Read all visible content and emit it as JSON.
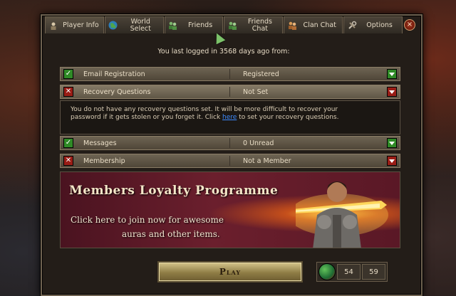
{
  "tabs": [
    {
      "label": "Player Info",
      "icon": "player-info-icon",
      "active": true
    },
    {
      "label": "World Select",
      "icon": "globe-icon",
      "active": false
    },
    {
      "label": "Friends",
      "icon": "friends-icon",
      "active": false
    },
    {
      "label": "Friends Chat",
      "icon": "friends-chat-icon",
      "active": false
    },
    {
      "label": "Clan Chat",
      "icon": "clan-chat-icon",
      "active": false
    },
    {
      "label": "Options",
      "icon": "options-icon",
      "active": false
    }
  ],
  "close_label": "×",
  "last_login": "You last logged in 3568 days ago from:",
  "rows": {
    "email": {
      "name": "Email Registration",
      "value": "Registered",
      "status": "ok"
    },
    "recovery": {
      "name": "Recovery Questions",
      "value": "Not Set",
      "status": "bad"
    },
    "messages": {
      "name": "Messages",
      "value": "0 Unread",
      "status": "ok"
    },
    "membership": {
      "name": "Membership",
      "value": "Not a Member",
      "status": "bad"
    }
  },
  "recovery_info": {
    "line1": "You do not have any recovery questions set. It will be more difficult to recover your",
    "line2_pre": "password if it gets stolen or you forget it. Click ",
    "link": "here",
    "line2_post": " to set your recovery questions."
  },
  "banner": {
    "title": "Members Loyalty Programme",
    "line1": "Click here to join now for awesome",
    "line2": "auras and other items."
  },
  "play_label": "Play",
  "counters": {
    "first": "54",
    "second": "59"
  },
  "colors": {
    "ok": "#2f8a26",
    "bad": "#9a1d16",
    "link": "#3d8bff"
  }
}
